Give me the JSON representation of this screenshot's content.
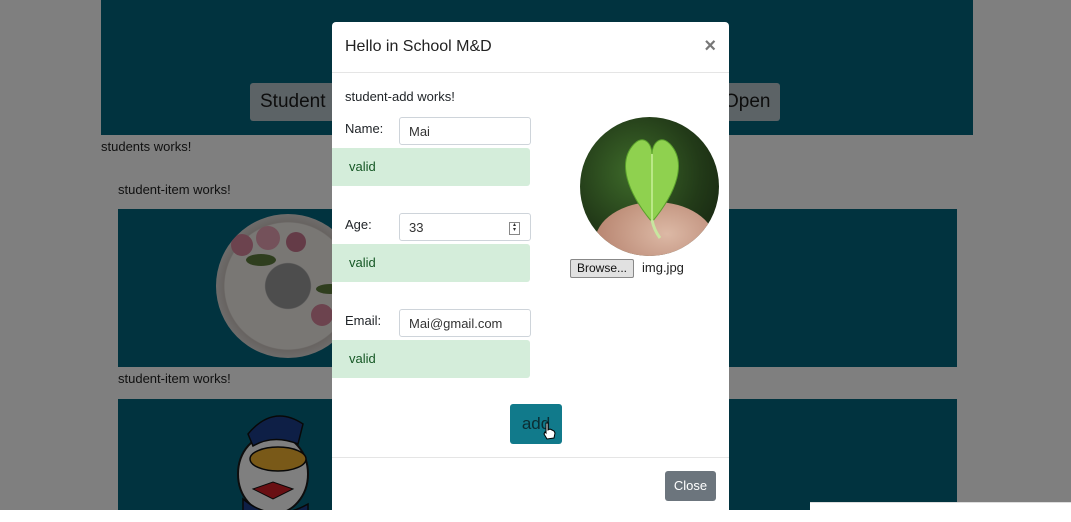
{
  "background": {
    "banner_buttons": [
      "Student",
      "Open"
    ],
    "students_text": "students works!",
    "items": [
      {
        "label": "student-item works!"
      },
      {
        "label": "student-item works!"
      }
    ]
  },
  "modal": {
    "title": "Hello in School M&D",
    "close_icon": "×",
    "works_text": "student-add works!",
    "fields": {
      "name": {
        "label": "Name:",
        "value": "Mai",
        "status": "valid"
      },
      "age": {
        "label": "Age:",
        "value": "33",
        "status": "valid"
      },
      "email": {
        "label": "Email:",
        "value": "Mai@gmail.com",
        "status": "valid"
      }
    },
    "file": {
      "browse_label": "Browse...",
      "filename": "img.jpg"
    },
    "add_label": "add",
    "close_label": "Close"
  },
  "colors": {
    "accent": "#03677e",
    "add_button": "#117a8b",
    "valid_bg": "#d4edda",
    "valid_text": "#155724"
  }
}
